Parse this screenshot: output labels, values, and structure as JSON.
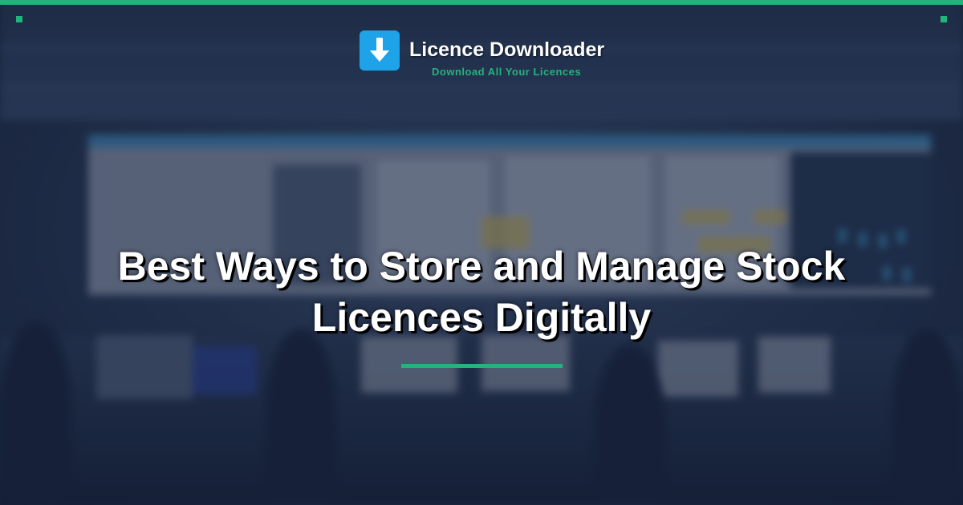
{
  "brand": {
    "name": "Licence Downloader",
    "tagline": "Download All Your Licences",
    "icon": "download-arrow-icon",
    "icon_color": "#1fa3e8"
  },
  "headline": {
    "line1": "Best Ways to Store and Manage Stock",
    "line2": "Licences Digitally"
  },
  "colors": {
    "accent": "#22b47a",
    "text": "#ffffff",
    "background": "#2a3a58"
  }
}
